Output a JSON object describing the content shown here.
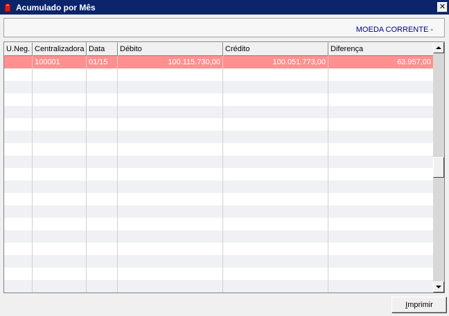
{
  "window": {
    "title": "Acumulado por Mês",
    "close_label": "✕"
  },
  "info_panel": {
    "currency": "MOEDA CORRENTE -"
  },
  "grid": {
    "columns": [
      "U.Neg.",
      "Centralizadora",
      "Data",
      "Débito",
      "Crédito",
      "Diferença"
    ],
    "rows": [
      {
        "u_neg": "",
        "centralizadora": "100001",
        "data": "01/15",
        "debito": "100.115.730,00",
        "credito": "100.051.773,00",
        "diferenca": "63.957,00"
      }
    ]
  },
  "footer": {
    "print_label": "Imprimir"
  },
  "colors": {
    "titlebar": "#0b246a",
    "selected_row": "#ff9090",
    "currency_text": "#000080"
  }
}
